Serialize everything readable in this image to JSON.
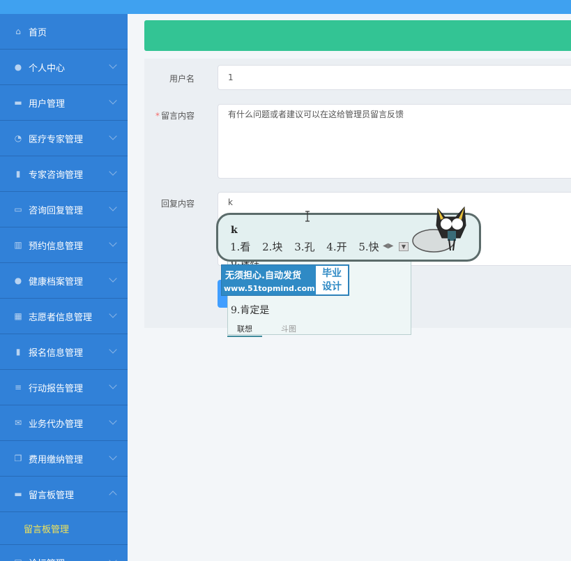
{
  "sidebar": {
    "items": [
      {
        "label": "首页",
        "icon": "home-icon",
        "expandable": false
      },
      {
        "label": "个人中心",
        "icon": "user-icon",
        "expandable": true
      },
      {
        "label": "用户管理",
        "icon": "monitor-icon",
        "expandable": true
      },
      {
        "label": "医疗专家管理",
        "icon": "gauge-icon",
        "expandable": true
      },
      {
        "label": "专家咨询管理",
        "icon": "clipboard-icon",
        "expandable": true
      },
      {
        "label": "咨询回复管理",
        "icon": "chat-icon",
        "expandable": true
      },
      {
        "label": "预约信息管理",
        "icon": "book-icon",
        "expandable": true
      },
      {
        "label": "健康档案管理",
        "icon": "user-icon",
        "expandable": true
      },
      {
        "label": "志愿者信息管理",
        "icon": "grid-icon",
        "expandable": true
      },
      {
        "label": "报名信息管理",
        "icon": "clipboard-icon",
        "expandable": true
      },
      {
        "label": "行动报告管理",
        "icon": "list-icon",
        "expandable": true
      },
      {
        "label": "业务代办管理",
        "icon": "mail-icon",
        "expandable": true
      },
      {
        "label": "费用缴纳管理",
        "icon": "copy-icon",
        "expandable": true
      },
      {
        "label": "留言板管理",
        "icon": "monitor-icon",
        "expandable": true,
        "expanded": true
      }
    ],
    "submenu_label": "留言板管理",
    "last_item": "论坛管理"
  },
  "form": {
    "username_label": "用户名",
    "username_value": "1",
    "message_required_mark": "*",
    "message_label": "留言内容",
    "message_value": "有什么问题或者建议可以在这给管理员留言反馈",
    "reply_label": "回复内容",
    "reply_value": "k"
  },
  "ime": {
    "composition": "k",
    "candidates": [
      "1.看",
      "2.块",
      "3.孔",
      "4.开",
      "5.快"
    ],
    "more_lines": [
      "6.课程",
      "9.肯定是"
    ],
    "tabs": [
      "联想",
      "斗图"
    ]
  },
  "ad": {
    "main": "无须担心.自动发货",
    "url": "www.51topmind.com",
    "side_line1": "毕业",
    "side_line2": "设计"
  },
  "colors": {
    "sidebar_bg": "#3181d8",
    "banner": "#33c494",
    "submenu_active": "#f0e35a",
    "primary_button": "#409eff"
  }
}
